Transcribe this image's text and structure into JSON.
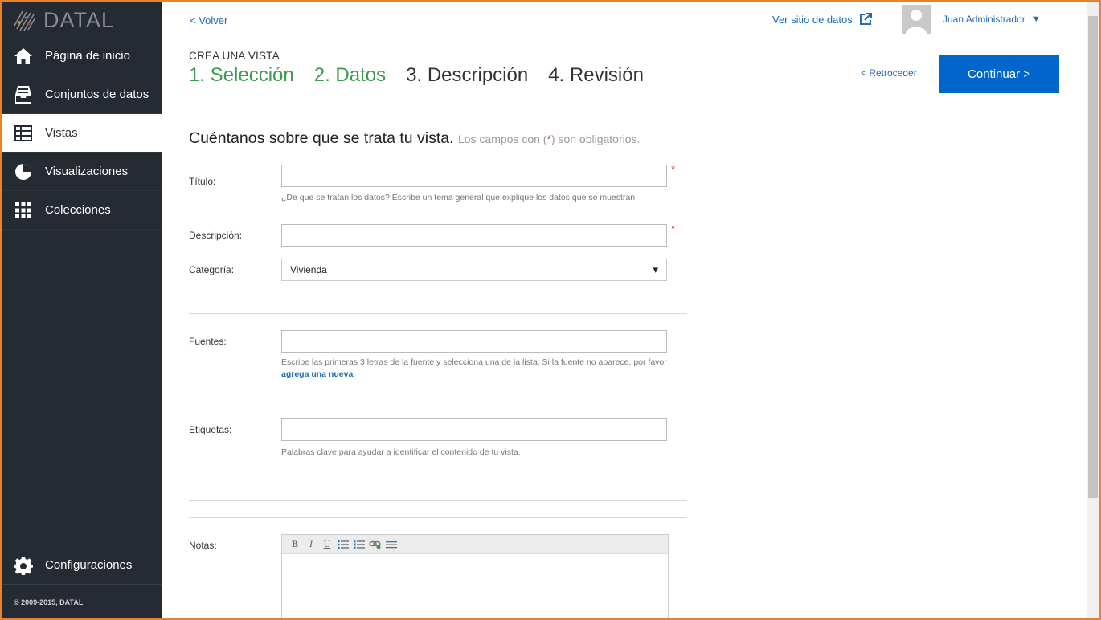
{
  "sidebar": {
    "logo_text": "DATAL",
    "items": [
      {
        "label": "Página de inicio",
        "icon": "home-icon"
      },
      {
        "label": "Conjuntos de datos",
        "icon": "inbox-icon"
      },
      {
        "label": "Vistas",
        "icon": "table-icon"
      },
      {
        "label": "Visualizaciones",
        "icon": "pie-chart-icon"
      },
      {
        "label": "Colecciones",
        "icon": "grid-icon"
      }
    ],
    "active_item": "Vistas",
    "settings_label": "Configuraciones",
    "copyright": "© 2009-2015, DATAL"
  },
  "header": {
    "back_label": "< Volver",
    "site_link_label": "Ver sitio de datos",
    "user_name": "Juan Administrador",
    "user_caret": "▼"
  },
  "wizard": {
    "eyebrow": "CREA UNA VISTA",
    "steps": [
      {
        "label": "1. Selección",
        "state": "done"
      },
      {
        "label": "2. Datos",
        "state": "done"
      },
      {
        "label": "3. Descripción",
        "state": "current"
      },
      {
        "label": "4. Revisión",
        "state": "todo"
      }
    ],
    "back_label": "< Retroceder",
    "continue_label": "Continuar >"
  },
  "form": {
    "heading": "Cuéntanos sobre que se trata tu vista.",
    "hint_before": "Los campos con (",
    "hint_star": "*",
    "hint_after": ") son obligatorios.",
    "required_mark": "*",
    "title_label": "Título:",
    "title_value": "",
    "title_help": "¿De que se tratan los datos? Escribe un tema general que explique los datos que se muestran.",
    "description_label": "Descripción:",
    "description_value": "",
    "category_label": "Categoría:",
    "category_value": "Vivienda",
    "category_caret": "▾",
    "sources_label": "Fuentes:",
    "sources_value": "",
    "sources_help": "Escribe las primeras 3 letras de la fuente y selecciona una de la lista. Si la fuente no aparece, por favor",
    "sources_help_link": "agrega una nueva",
    "sources_help_end": ".",
    "tags_label": "Etiquetas:",
    "tags_value": "",
    "tags_help": "Palabras clave para ayudar a identificar el contenido de tu vista.",
    "notes_label": "Notas:",
    "editor_buttons": [
      {
        "glyph": "B",
        "icon": "bold-icon"
      },
      {
        "glyph": "I",
        "icon": "italic-icon"
      },
      {
        "glyph": "U",
        "icon": "underline-icon"
      }
    ]
  },
  "colors": {
    "sidebar_bg": "#262a33",
    "accent_blue": "#0066cc",
    "step_done_green": "#3d9a4f",
    "required_red": "#c0392b"
  }
}
